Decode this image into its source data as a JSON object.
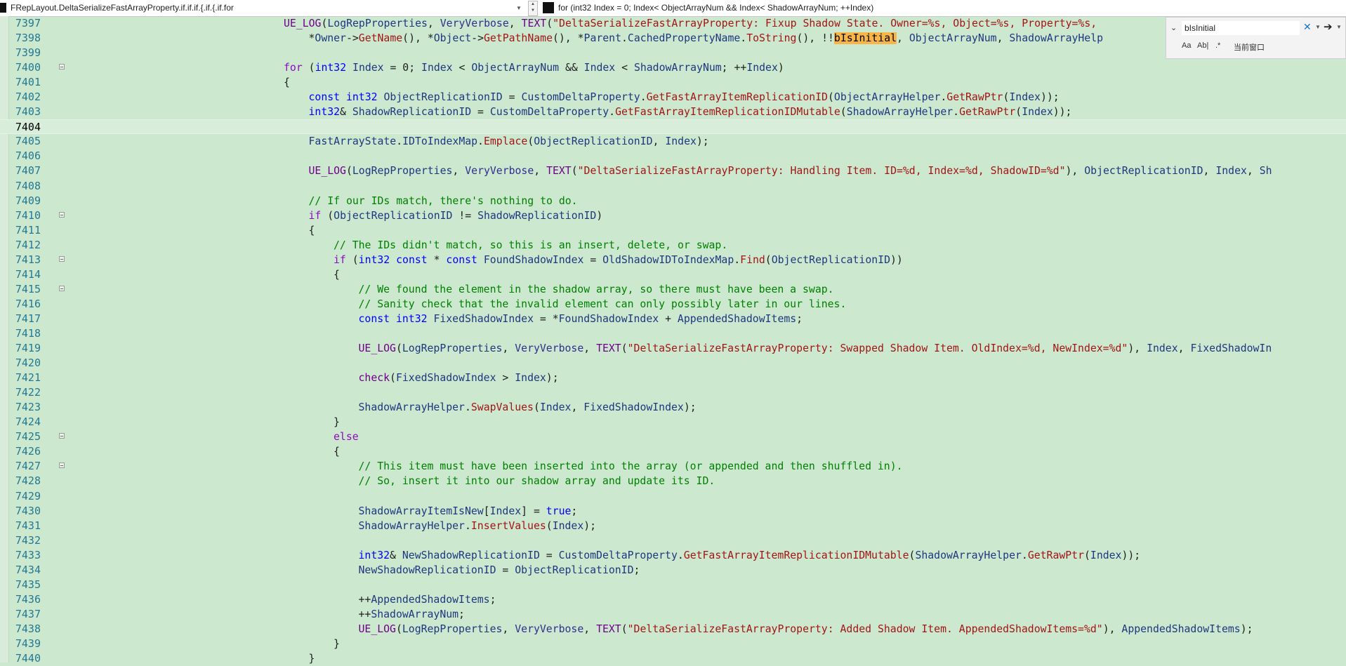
{
  "navbar": {
    "left": "FRepLayout.DeltaSerializeFastArrayProperty.if.if.if.{.if.{.if.for",
    "right": "for (int32 Index = 0; Index< ObjectArrayNum && Index< ShadowArrayNum; ++Index)"
  },
  "find": {
    "value": "bIsInitial",
    "opt_case": "Aa",
    "opt_word": "Ab|",
    "opt_regex": ".*",
    "scope": "当前窗口"
  },
  "editor": {
    "current_line": "7404",
    "lines": [
      {
        "n": "7397",
        "tokens": [
          [
            "macro",
            "UE_LOG"
          ],
          [
            "p",
            "("
          ],
          [
            "var",
            "LogRepProperties"
          ],
          [
            "p",
            ", "
          ],
          [
            "mem",
            "VeryVerbose"
          ],
          [
            "p",
            ", "
          ],
          [
            "macro",
            "TEXT"
          ],
          [
            "p",
            "("
          ],
          [
            "str",
            "\"DeltaSerializeFastArrayProperty: Fixup Shadow State. Owner=%s, Object=%s, Property=%s, "
          ]
        ],
        "indent": 0
      },
      {
        "n": "7398",
        "tokens": [
          [
            "p",
            "*"
          ],
          [
            "var",
            "Owner"
          ],
          [
            "p",
            "->"
          ],
          [
            "fnc",
            "GetName"
          ],
          [
            "p",
            "(), *"
          ],
          [
            "var",
            "Object"
          ],
          [
            "p",
            "->"
          ],
          [
            "fnc",
            "GetPathName"
          ],
          [
            "p",
            "(), *"
          ],
          [
            "var",
            "Parent"
          ],
          [
            "p",
            "."
          ],
          [
            "var",
            "CachedPropertyName"
          ],
          [
            "p",
            "."
          ],
          [
            "fnc",
            "ToString"
          ],
          [
            "p",
            "(), !!"
          ],
          [
            "hl",
            "bIsInitial"
          ],
          [
            "p",
            ", "
          ],
          [
            "var",
            "ObjectArrayNum"
          ],
          [
            "p",
            ", "
          ],
          [
            "var",
            "ShadowArrayHelp"
          ]
        ],
        "indent": 1
      },
      {
        "n": "7399",
        "tokens": [],
        "indent": 0
      },
      {
        "n": "7400",
        "tokens": [
          [
            "ctl",
            "for"
          ],
          [
            "p",
            " ("
          ],
          [
            "kw",
            "int32"
          ],
          [
            "p",
            " "
          ],
          [
            "var",
            "Index"
          ],
          [
            "p",
            " = 0; "
          ],
          [
            "var",
            "Index"
          ],
          [
            "p",
            " < "
          ],
          [
            "var",
            "ObjectArrayNum"
          ],
          [
            "p",
            " && "
          ],
          [
            "var",
            "Index"
          ],
          [
            "p",
            " < "
          ],
          [
            "var",
            "ShadowArrayNum"
          ],
          [
            "p",
            "; ++"
          ],
          [
            "var",
            "Index"
          ],
          [
            "p",
            ")"
          ]
        ],
        "indent": 0,
        "fold": true
      },
      {
        "n": "7401",
        "tokens": [
          [
            "p",
            "{"
          ]
        ],
        "indent": 0
      },
      {
        "n": "7402",
        "tokens": [
          [
            "kw",
            "const"
          ],
          [
            "p",
            " "
          ],
          [
            "kw",
            "int32"
          ],
          [
            "p",
            " "
          ],
          [
            "var",
            "ObjectReplicationID"
          ],
          [
            "p",
            " = "
          ],
          [
            "var",
            "CustomDeltaProperty"
          ],
          [
            "p",
            "."
          ],
          [
            "fnc",
            "GetFastArrayItemReplicationID"
          ],
          [
            "p",
            "("
          ],
          [
            "var",
            "ObjectArrayHelper"
          ],
          [
            "p",
            "."
          ],
          [
            "fnc",
            "GetRawPtr"
          ],
          [
            "p",
            "("
          ],
          [
            "var",
            "Index"
          ],
          [
            "p",
            "));"
          ]
        ],
        "indent": 1
      },
      {
        "n": "7403",
        "tokens": [
          [
            "kw",
            "int32"
          ],
          [
            "p",
            "& "
          ],
          [
            "var",
            "ShadowReplicationID"
          ],
          [
            "p",
            " = "
          ],
          [
            "var",
            "CustomDeltaProperty"
          ],
          [
            "p",
            "."
          ],
          [
            "fnc",
            "GetFastArrayItemReplicationIDMutable"
          ],
          [
            "p",
            "("
          ],
          [
            "var",
            "ShadowArrayHelper"
          ],
          [
            "p",
            "."
          ],
          [
            "fnc",
            "GetRawPtr"
          ],
          [
            "p",
            "("
          ],
          [
            "var",
            "Index"
          ],
          [
            "p",
            "));"
          ]
        ],
        "indent": 1
      },
      {
        "n": "7404",
        "tokens": [],
        "indent": 0
      },
      {
        "n": "7405",
        "tokens": [
          [
            "var",
            "FastArrayState"
          ],
          [
            "p",
            "."
          ],
          [
            "var",
            "IDToIndexMap"
          ],
          [
            "p",
            "."
          ],
          [
            "fnc",
            "Emplace"
          ],
          [
            "p",
            "("
          ],
          [
            "var",
            "ObjectReplicationID"
          ],
          [
            "p",
            ", "
          ],
          [
            "var",
            "Index"
          ],
          [
            "p",
            ");"
          ]
        ],
        "indent": 1
      },
      {
        "n": "7406",
        "tokens": [],
        "indent": 0
      },
      {
        "n": "7407",
        "tokens": [
          [
            "macro",
            "UE_LOG"
          ],
          [
            "p",
            "("
          ],
          [
            "var",
            "LogRepProperties"
          ],
          [
            "p",
            ", "
          ],
          [
            "mem",
            "VeryVerbose"
          ],
          [
            "p",
            ", "
          ],
          [
            "macro",
            "TEXT"
          ],
          [
            "p",
            "("
          ],
          [
            "str",
            "\"DeltaSerializeFastArrayProperty: Handling Item. ID=%d, Index=%d, ShadowID=%d\""
          ],
          [
            "p",
            "), "
          ],
          [
            "var",
            "ObjectReplicationID"
          ],
          [
            "p",
            ", "
          ],
          [
            "var",
            "Index"
          ],
          [
            "p",
            ", "
          ],
          [
            "var",
            "Sh"
          ]
        ],
        "indent": 1
      },
      {
        "n": "7408",
        "tokens": [],
        "indent": 0
      },
      {
        "n": "7409",
        "tokens": [
          [
            "cmt",
            "// If our IDs match, there's nothing to do."
          ]
        ],
        "indent": 1
      },
      {
        "n": "7410",
        "tokens": [
          [
            "ctl",
            "if"
          ],
          [
            "p",
            " ("
          ],
          [
            "var",
            "ObjectReplicationID"
          ],
          [
            "p",
            " != "
          ],
          [
            "var",
            "ShadowReplicationID"
          ],
          [
            "p",
            ")"
          ]
        ],
        "indent": 1,
        "fold": true
      },
      {
        "n": "7411",
        "tokens": [
          [
            "p",
            "{"
          ]
        ],
        "indent": 1
      },
      {
        "n": "7412",
        "tokens": [
          [
            "cmt",
            "// The IDs didn't match, so this is an insert, delete, or swap."
          ]
        ],
        "indent": 2
      },
      {
        "n": "7413",
        "tokens": [
          [
            "ctl",
            "if"
          ],
          [
            "p",
            " ("
          ],
          [
            "kw",
            "int32"
          ],
          [
            "p",
            " "
          ],
          [
            "kw",
            "const"
          ],
          [
            "p",
            " * "
          ],
          [
            "kw",
            "const"
          ],
          [
            "p",
            " "
          ],
          [
            "var",
            "FoundShadowIndex"
          ],
          [
            "p",
            " = "
          ],
          [
            "var",
            "OldShadowIDToIndexMap"
          ],
          [
            "p",
            "."
          ],
          [
            "fnc",
            "Find"
          ],
          [
            "p",
            "("
          ],
          [
            "var",
            "ObjectReplicationID"
          ],
          [
            "p",
            "))"
          ]
        ],
        "indent": 2,
        "fold": true
      },
      {
        "n": "7414",
        "tokens": [
          [
            "p",
            "{"
          ]
        ],
        "indent": 2
      },
      {
        "n": "7415",
        "tokens": [
          [
            "cmt",
            "// We found the element in the shadow array, so there must have been a swap."
          ]
        ],
        "indent": 3,
        "fold": true
      },
      {
        "n": "7416",
        "tokens": [
          [
            "cmt",
            "// Sanity check that the invalid element can only possibly later in our lines."
          ]
        ],
        "indent": 3
      },
      {
        "n": "7417",
        "tokens": [
          [
            "kw",
            "const"
          ],
          [
            "p",
            " "
          ],
          [
            "kw",
            "int32"
          ],
          [
            "p",
            " "
          ],
          [
            "var",
            "FixedShadowIndex"
          ],
          [
            "p",
            " = *"
          ],
          [
            "var",
            "FoundShadowIndex"
          ],
          [
            "p",
            " + "
          ],
          [
            "var",
            "AppendedShadowItems"
          ],
          [
            "p",
            ";"
          ]
        ],
        "indent": 3
      },
      {
        "n": "7418",
        "tokens": [],
        "indent": 0
      },
      {
        "n": "7419",
        "tokens": [
          [
            "macro",
            "UE_LOG"
          ],
          [
            "p",
            "("
          ],
          [
            "var",
            "LogRepProperties"
          ],
          [
            "p",
            ", "
          ],
          [
            "mem",
            "VeryVerbose"
          ],
          [
            "p",
            ", "
          ],
          [
            "macro",
            "TEXT"
          ],
          [
            "p",
            "("
          ],
          [
            "str",
            "\"DeltaSerializeFastArrayProperty: Swapped Shadow Item. OldIndex=%d, NewIndex=%d\""
          ],
          [
            "p",
            "), "
          ],
          [
            "var",
            "Index"
          ],
          [
            "p",
            ", "
          ],
          [
            "var",
            "FixedShadowIn"
          ]
        ],
        "indent": 3
      },
      {
        "n": "7420",
        "tokens": [],
        "indent": 0
      },
      {
        "n": "7421",
        "tokens": [
          [
            "macro",
            "check"
          ],
          [
            "p",
            "("
          ],
          [
            "var",
            "FixedShadowIndex"
          ],
          [
            "p",
            " > "
          ],
          [
            "var",
            "Index"
          ],
          [
            "p",
            ");"
          ]
        ],
        "indent": 3
      },
      {
        "n": "7422",
        "tokens": [],
        "indent": 0
      },
      {
        "n": "7423",
        "tokens": [
          [
            "var",
            "ShadowArrayHelper"
          ],
          [
            "p",
            "."
          ],
          [
            "fnc",
            "SwapValues"
          ],
          [
            "p",
            "("
          ],
          [
            "var",
            "Index"
          ],
          [
            "p",
            ", "
          ],
          [
            "var",
            "FixedShadowIndex"
          ],
          [
            "p",
            ");"
          ]
        ],
        "indent": 3
      },
      {
        "n": "7424",
        "tokens": [
          [
            "p",
            "}"
          ]
        ],
        "indent": 2
      },
      {
        "n": "7425",
        "tokens": [
          [
            "ctl",
            "else"
          ]
        ],
        "indent": 2,
        "fold": true
      },
      {
        "n": "7426",
        "tokens": [
          [
            "p",
            "{"
          ]
        ],
        "indent": 2
      },
      {
        "n": "7427",
        "tokens": [
          [
            "cmt",
            "// This item must have been inserted into the array (or appended and then shuffled in)."
          ]
        ],
        "indent": 3,
        "fold": true
      },
      {
        "n": "7428",
        "tokens": [
          [
            "cmt",
            "// So, insert it into our shadow array and update its ID."
          ]
        ],
        "indent": 3
      },
      {
        "n": "7429",
        "tokens": [],
        "indent": 0
      },
      {
        "n": "7430",
        "tokens": [
          [
            "var",
            "ShadowArrayItemIsNew"
          ],
          [
            "p",
            "["
          ],
          [
            "var",
            "Index"
          ],
          [
            "p",
            "] = "
          ],
          [
            "kw",
            "true"
          ],
          [
            "p",
            ";"
          ]
        ],
        "indent": 3
      },
      {
        "n": "7431",
        "tokens": [
          [
            "var",
            "ShadowArrayHelper"
          ],
          [
            "p",
            "."
          ],
          [
            "fnc",
            "InsertValues"
          ],
          [
            "p",
            "("
          ],
          [
            "var",
            "Index"
          ],
          [
            "p",
            ");"
          ]
        ],
        "indent": 3
      },
      {
        "n": "7432",
        "tokens": [],
        "indent": 0
      },
      {
        "n": "7433",
        "tokens": [
          [
            "kw",
            "int32"
          ],
          [
            "p",
            "& "
          ],
          [
            "var",
            "NewShadowReplicationID"
          ],
          [
            "p",
            " = "
          ],
          [
            "var",
            "CustomDeltaProperty"
          ],
          [
            "p",
            "."
          ],
          [
            "fnc",
            "GetFastArrayItemReplicationIDMutable"
          ],
          [
            "p",
            "("
          ],
          [
            "var",
            "ShadowArrayHelper"
          ],
          [
            "p",
            "."
          ],
          [
            "fnc",
            "GetRawPtr"
          ],
          [
            "p",
            "("
          ],
          [
            "var",
            "Index"
          ],
          [
            "p",
            "));"
          ]
        ],
        "indent": 3
      },
      {
        "n": "7434",
        "tokens": [
          [
            "var",
            "NewShadowReplicationID"
          ],
          [
            "p",
            " = "
          ],
          [
            "var",
            "ObjectReplicationID"
          ],
          [
            "p",
            ";"
          ]
        ],
        "indent": 3
      },
      {
        "n": "7435",
        "tokens": [],
        "indent": 0
      },
      {
        "n": "7436",
        "tokens": [
          [
            "p",
            "++"
          ],
          [
            "var",
            "AppendedShadowItems"
          ],
          [
            "p",
            ";"
          ]
        ],
        "indent": 3
      },
      {
        "n": "7437",
        "tokens": [
          [
            "p",
            "++"
          ],
          [
            "var",
            "ShadowArrayNum"
          ],
          [
            "p",
            ";"
          ]
        ],
        "indent": 3
      },
      {
        "n": "7438",
        "tokens": [
          [
            "macro",
            "UE_LOG"
          ],
          [
            "p",
            "("
          ],
          [
            "var",
            "LogRepProperties"
          ],
          [
            "p",
            ", "
          ],
          [
            "mem",
            "VeryVerbose"
          ],
          [
            "p",
            ", "
          ],
          [
            "macro",
            "TEXT"
          ],
          [
            "p",
            "("
          ],
          [
            "str",
            "\"DeltaSerializeFastArrayProperty: Added Shadow Item. AppendedShadowItems=%d\""
          ],
          [
            "p",
            "), "
          ],
          [
            "var",
            "AppendedShadowItems"
          ],
          [
            "p",
            ");"
          ]
        ],
        "indent": 3
      },
      {
        "n": "7439",
        "tokens": [
          [
            "p",
            "}"
          ]
        ],
        "indent": 2
      },
      {
        "n": "7440",
        "tokens": [
          [
            "p",
            "}"
          ]
        ],
        "indent": 1
      }
    ]
  }
}
